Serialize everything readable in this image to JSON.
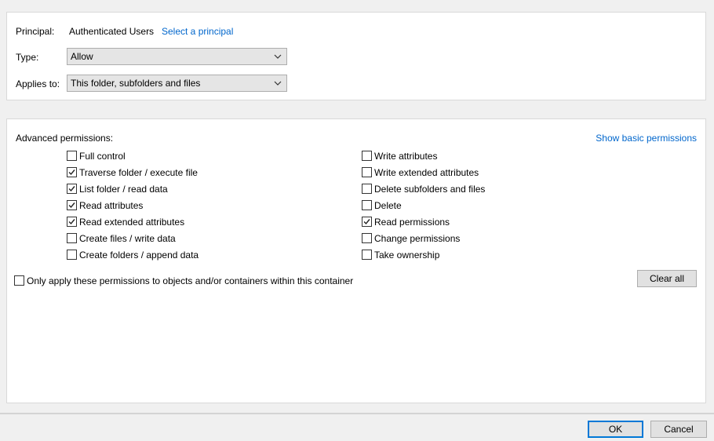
{
  "principal": {
    "label": "Principal:",
    "value": "Authenticated Users",
    "link": "Select a principal"
  },
  "type": {
    "label": "Type:",
    "value": "Allow"
  },
  "applies_to": {
    "label": "Applies to:",
    "value": "This folder, subfolders and files"
  },
  "advanced": {
    "title": "Advanced permissions:",
    "show_basic_link": "Show basic permissions",
    "left": [
      {
        "label": "Full control",
        "checked": false
      },
      {
        "label": "Traverse folder / execute file",
        "checked": true
      },
      {
        "label": "List folder / read data",
        "checked": true
      },
      {
        "label": "Read attributes",
        "checked": true
      },
      {
        "label": "Read extended attributes",
        "checked": true
      },
      {
        "label": "Create files / write data",
        "checked": false
      },
      {
        "label": "Create folders / append data",
        "checked": false
      }
    ],
    "right": [
      {
        "label": "Write attributes",
        "checked": false
      },
      {
        "label": "Write extended attributes",
        "checked": false
      },
      {
        "label": "Delete subfolders and files",
        "checked": false
      },
      {
        "label": "Delete",
        "checked": false
      },
      {
        "label": "Read permissions",
        "checked": true
      },
      {
        "label": "Change permissions",
        "checked": false
      },
      {
        "label": "Take ownership",
        "checked": false
      }
    ],
    "only_apply": {
      "label": "Only apply these permissions to objects and/or containers within this container",
      "checked": false
    },
    "clear_all": "Clear all"
  },
  "footer": {
    "ok": "OK",
    "cancel": "Cancel"
  }
}
